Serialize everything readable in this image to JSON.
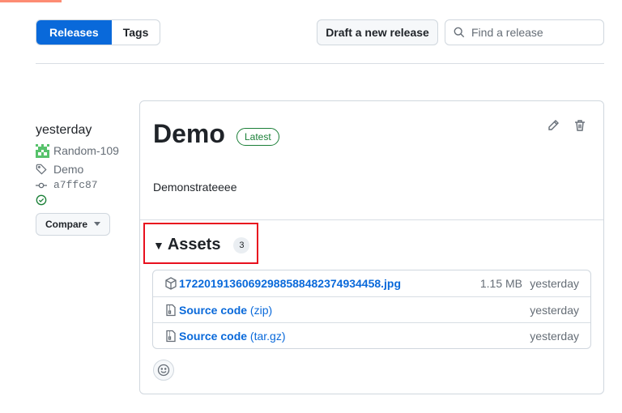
{
  "nav": {
    "tabs": [
      {
        "label": "Releases",
        "active": true
      },
      {
        "label": "Tags",
        "active": false
      }
    ],
    "draft_label": "Draft a new release",
    "search_placeholder": "Find a release"
  },
  "sidebar": {
    "date": "yesterday",
    "author": "Random-109",
    "tag": "Demo",
    "commit": "a7ffc87",
    "compare_label": "Compare"
  },
  "release": {
    "title": "Demo",
    "badge": "Latest",
    "body": "Demonstrateeee",
    "assets_label": "Assets",
    "assets_count": "3",
    "assets": [
      {
        "name": "17220191360692988588482374934458.jpg",
        "size": "1.15 MB",
        "date": "yesterday",
        "icon": "package-icon"
      },
      {
        "name": "Source code",
        "ext": "(zip)",
        "size": "",
        "date": "yesterday",
        "icon": "file-zip-icon"
      },
      {
        "name": "Source code",
        "ext": "(tar.gz)",
        "size": "",
        "date": "yesterday",
        "icon": "file-zip-icon"
      }
    ]
  },
  "colors": {
    "accent": "#0969da",
    "success": "#1a7f37",
    "highlight": "#e8101e",
    "avatar": "#57c26b"
  }
}
